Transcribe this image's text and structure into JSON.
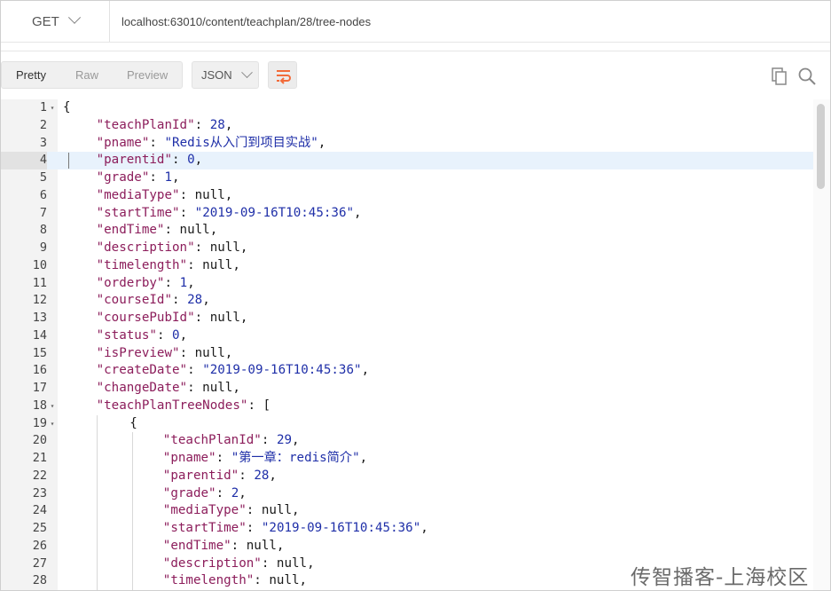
{
  "request": {
    "method": "GET",
    "url": "localhost:63010/content/teachplan/28/tree-nodes"
  },
  "response_toolbar": {
    "view_tabs": [
      "Pretty",
      "Raw",
      "Preview"
    ],
    "active_view": "Pretty",
    "format": "JSON"
  },
  "icons": {
    "method_dropdown": "chevron-down-icon",
    "format_dropdown": "chevron-down-icon",
    "wrap": "wrap-lines-icon",
    "copy": "copy-icon",
    "search": "search-icon"
  },
  "colors": {
    "accent": "#f26b3a",
    "key": "#8c1d5b",
    "string": "#1f2fa8",
    "number": "#1f2fa8",
    "active_line": "#e8f2fc"
  },
  "code": {
    "active_line": 4,
    "lines": [
      {
        "n": 1,
        "fold": true,
        "indent": 0,
        "tokens": [
          {
            "p": "{"
          }
        ]
      },
      {
        "n": 2,
        "indent": 1,
        "tokens": [
          {
            "k": "\"teachPlanId\""
          },
          {
            "p": ": "
          },
          {
            "n": "28"
          },
          {
            "p": ","
          }
        ]
      },
      {
        "n": 3,
        "indent": 1,
        "tokens": [
          {
            "k": "\"pname\""
          },
          {
            "p": ": "
          },
          {
            "s": "\"Redis从入门到项目实战\""
          },
          {
            "p": ","
          }
        ]
      },
      {
        "n": 4,
        "indent": 1,
        "tokens": [
          {
            "k": "\"parentid\""
          },
          {
            "p": ": "
          },
          {
            "n": "0"
          },
          {
            "p": ","
          }
        ]
      },
      {
        "n": 5,
        "indent": 1,
        "tokens": [
          {
            "k": "\"grade\""
          },
          {
            "p": ": "
          },
          {
            "n": "1"
          },
          {
            "p": ","
          }
        ]
      },
      {
        "n": 6,
        "indent": 1,
        "tokens": [
          {
            "k": "\"mediaType\""
          },
          {
            "p": ": null,"
          }
        ]
      },
      {
        "n": 7,
        "indent": 1,
        "tokens": [
          {
            "k": "\"startTime\""
          },
          {
            "p": ": "
          },
          {
            "s": "\"2019-09-16T10:45:36\""
          },
          {
            "p": ","
          }
        ]
      },
      {
        "n": 8,
        "indent": 1,
        "tokens": [
          {
            "k": "\"endTime\""
          },
          {
            "p": ": null,"
          }
        ]
      },
      {
        "n": 9,
        "indent": 1,
        "tokens": [
          {
            "k": "\"description\""
          },
          {
            "p": ": null,"
          }
        ]
      },
      {
        "n": 10,
        "indent": 1,
        "tokens": [
          {
            "k": "\"timelength\""
          },
          {
            "p": ": null,"
          }
        ]
      },
      {
        "n": 11,
        "indent": 1,
        "tokens": [
          {
            "k": "\"orderby\""
          },
          {
            "p": ": "
          },
          {
            "n": "1"
          },
          {
            "p": ","
          }
        ]
      },
      {
        "n": 12,
        "indent": 1,
        "tokens": [
          {
            "k": "\"courseId\""
          },
          {
            "p": ": "
          },
          {
            "n": "28"
          },
          {
            "p": ","
          }
        ]
      },
      {
        "n": 13,
        "indent": 1,
        "tokens": [
          {
            "k": "\"coursePubId\""
          },
          {
            "p": ": null,"
          }
        ]
      },
      {
        "n": 14,
        "indent": 1,
        "tokens": [
          {
            "k": "\"status\""
          },
          {
            "p": ": "
          },
          {
            "n": "0"
          },
          {
            "p": ","
          }
        ]
      },
      {
        "n": 15,
        "indent": 1,
        "tokens": [
          {
            "k": "\"isPreview\""
          },
          {
            "p": ": null,"
          }
        ]
      },
      {
        "n": 16,
        "indent": 1,
        "tokens": [
          {
            "k": "\"createDate\""
          },
          {
            "p": ": "
          },
          {
            "s": "\"2019-09-16T10:45:36\""
          },
          {
            "p": ","
          }
        ]
      },
      {
        "n": 17,
        "indent": 1,
        "tokens": [
          {
            "k": "\"changeDate\""
          },
          {
            "p": ": null,"
          }
        ]
      },
      {
        "n": 18,
        "fold": true,
        "indent": 1,
        "tokens": [
          {
            "k": "\"teachPlanTreeNodes\""
          },
          {
            "p": ": ["
          }
        ]
      },
      {
        "n": 19,
        "fold": true,
        "indent": 2,
        "tokens": [
          {
            "p": "{"
          }
        ]
      },
      {
        "n": 20,
        "indent": 3,
        "tokens": [
          {
            "k": "\"teachPlanId\""
          },
          {
            "p": ": "
          },
          {
            "n": "29"
          },
          {
            "p": ","
          }
        ]
      },
      {
        "n": 21,
        "indent": 3,
        "tokens": [
          {
            "k": "\"pname\""
          },
          {
            "p": ": "
          },
          {
            "s": "\"第一章：redis简介\""
          },
          {
            "p": ","
          }
        ]
      },
      {
        "n": 22,
        "indent": 3,
        "tokens": [
          {
            "k": "\"parentid\""
          },
          {
            "p": ": "
          },
          {
            "n": "28"
          },
          {
            "p": ","
          }
        ]
      },
      {
        "n": 23,
        "indent": 3,
        "tokens": [
          {
            "k": "\"grade\""
          },
          {
            "p": ": "
          },
          {
            "n": "2"
          },
          {
            "p": ","
          }
        ]
      },
      {
        "n": 24,
        "indent": 3,
        "tokens": [
          {
            "k": "\"mediaType\""
          },
          {
            "p": ": null,"
          }
        ]
      },
      {
        "n": 25,
        "indent": 3,
        "tokens": [
          {
            "k": "\"startTime\""
          },
          {
            "p": ": "
          },
          {
            "s": "\"2019-09-16T10:45:36\""
          },
          {
            "p": ","
          }
        ]
      },
      {
        "n": 26,
        "indent": 3,
        "tokens": [
          {
            "k": "\"endTime\""
          },
          {
            "p": ": null,"
          }
        ]
      },
      {
        "n": 27,
        "indent": 3,
        "tokens": [
          {
            "k": "\"description\""
          },
          {
            "p": ": null,"
          }
        ]
      },
      {
        "n": 28,
        "indent": 3,
        "tokens": [
          {
            "k": "\"timelength\""
          },
          {
            "p": ": null,"
          }
        ]
      }
    ]
  },
  "watermark": "传智播客-上海校区"
}
